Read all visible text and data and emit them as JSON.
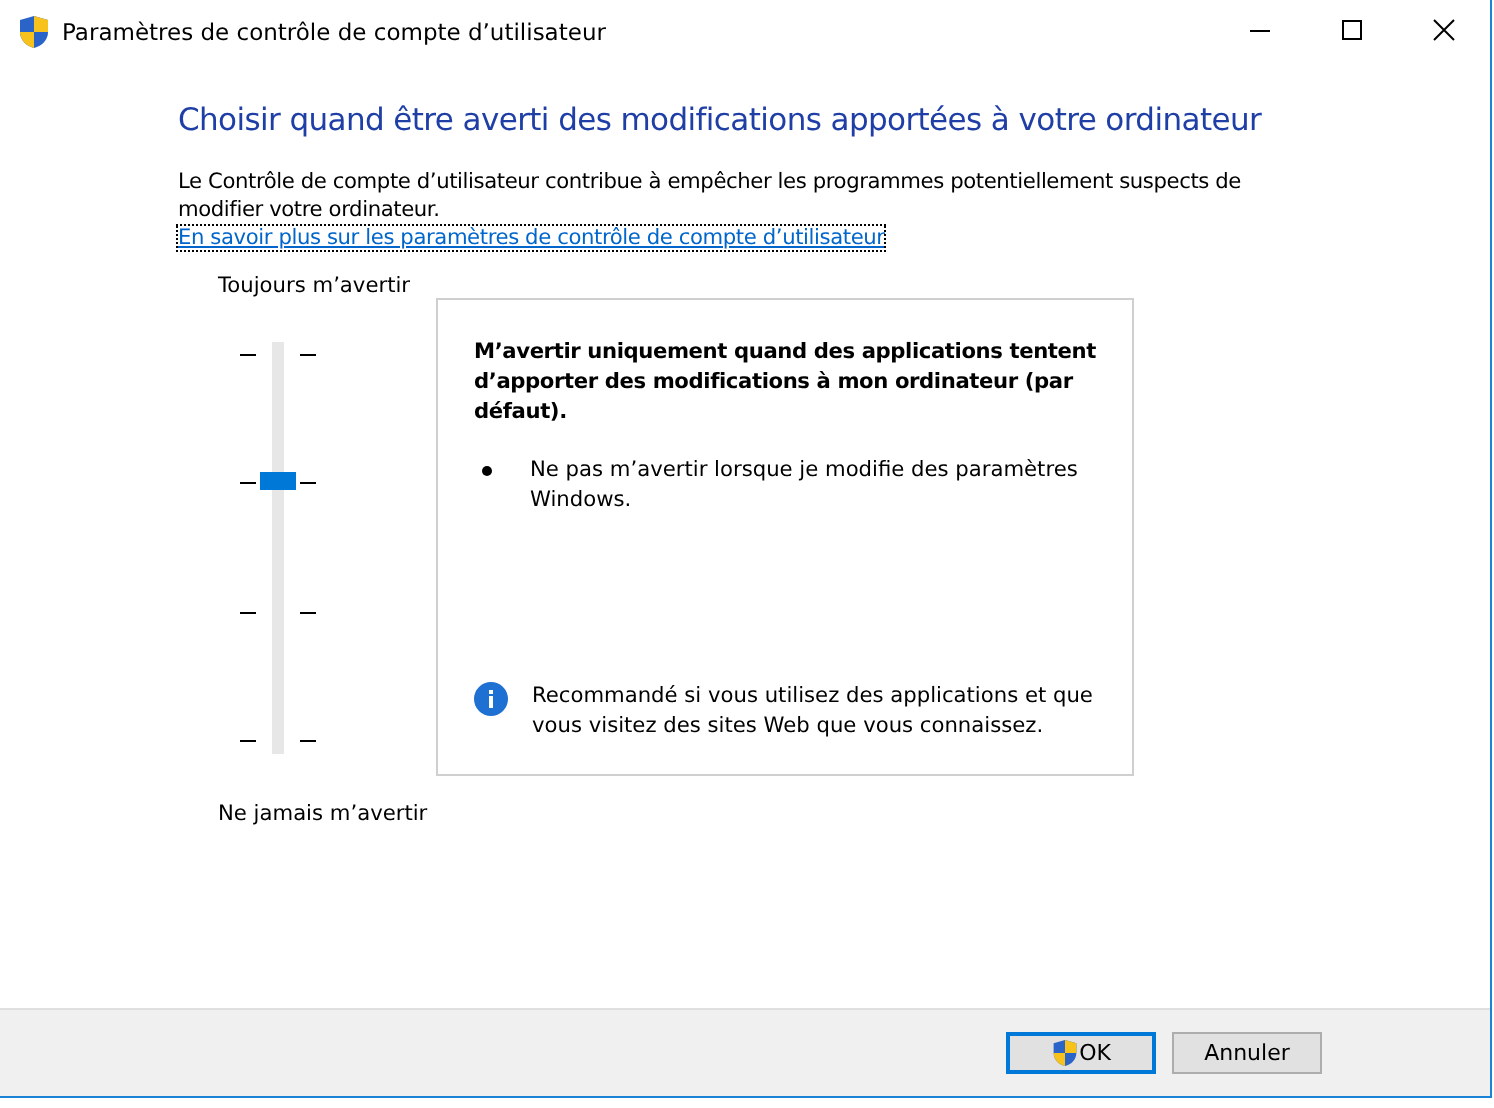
{
  "window": {
    "title": "Paramètres de contrôle de compte d’utilisateur"
  },
  "heading": "Choisir quand être averti des modifications apportées à votre ordinateur",
  "description": "Le Contrôle de compte d’utilisateur contribue à empêcher les programmes potentiellement suspects de modifier votre ordinateur.",
  "link": "En savoir plus sur les paramètres de contrôle de compte d’utilisateur",
  "slider": {
    "top_label": "Toujours m’avertir",
    "bottom_label": "Ne jamais m’avertir",
    "level": 0.6667
  },
  "details": {
    "title": "M’avertir uniquement quand des applications tentent d’apporter des modifications à mon ordinateur (par défaut).",
    "bullets": [
      "Ne pas m’avertir lorsque je modifie des paramètres Windows."
    ],
    "note": "Recommandé si vous utilisez des applications et que vous visitez des sites Web que vous connaissez."
  },
  "buttons": [
    {
      "label": "OK",
      "kind": "shield",
      "selected": true
    },
    {
      "label": "Annuler",
      "kind": "plain",
      "selected": false
    }
  ]
}
